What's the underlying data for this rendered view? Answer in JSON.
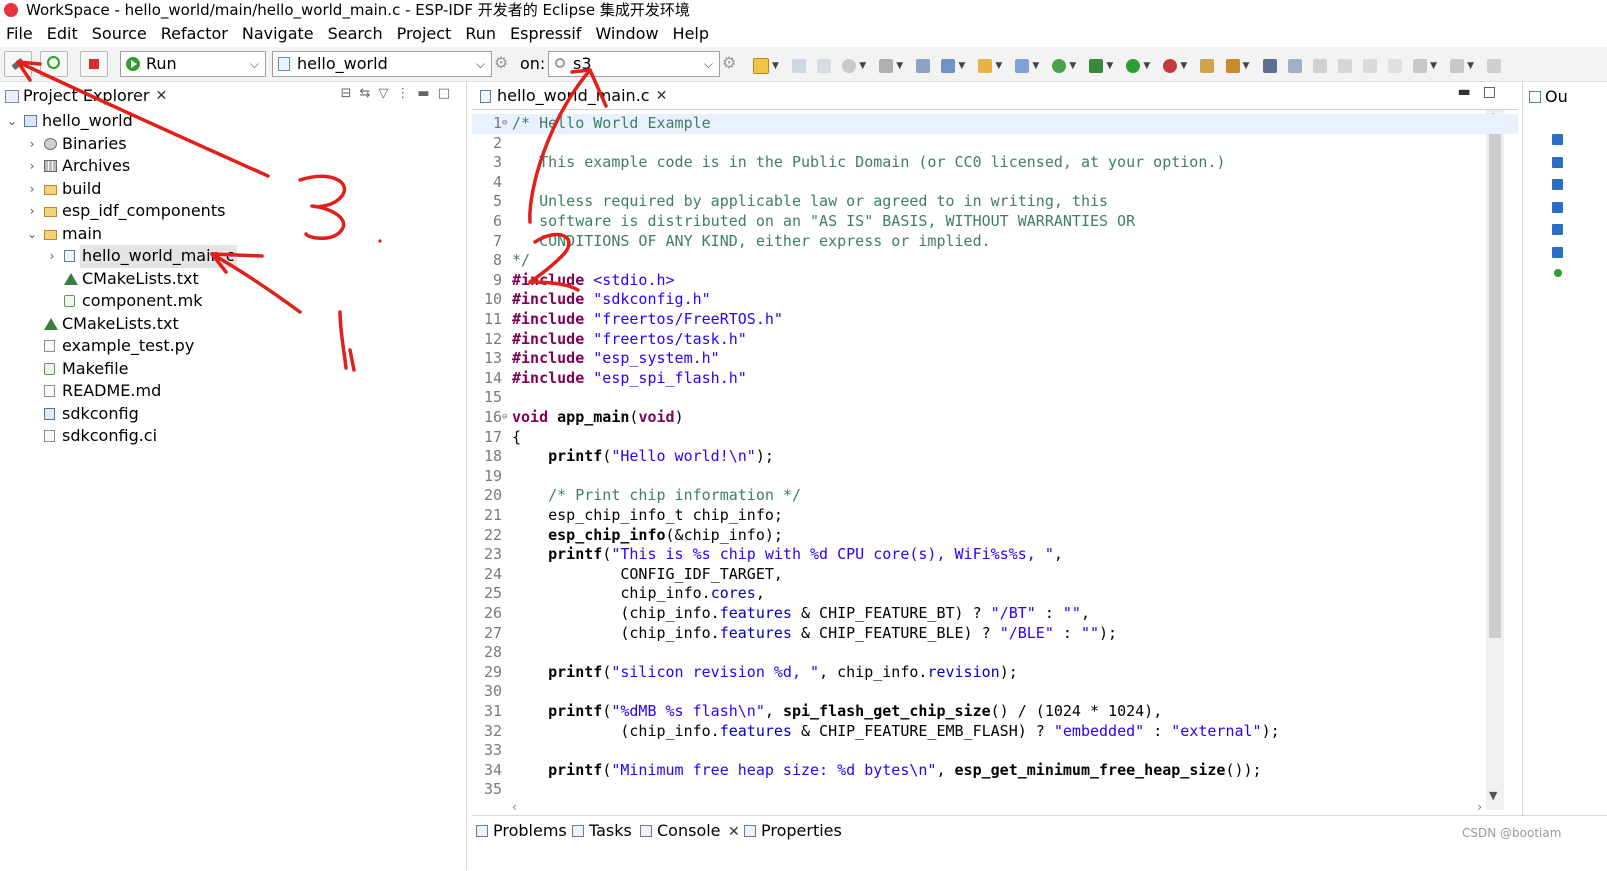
{
  "titlebar": {
    "title": "WorkSpace - hello_world/main/hello_world_main.c - ESP-IDF 开发者的 Eclipse 集成开发环境"
  },
  "menu": [
    "File",
    "Edit",
    "Source",
    "Refactor",
    "Navigate",
    "Search",
    "Project",
    "Run",
    "Espressif",
    "Window",
    "Help"
  ],
  "toolbar": {
    "launch_mode": "Run",
    "launch_config": "hello_world",
    "on_label": "on:",
    "target": "s3"
  },
  "project_explorer": {
    "tab_label": "Project Explorer",
    "tree": [
      {
        "label": "hello_world",
        "depth": 0,
        "chevron": "⌄",
        "icon": "project-icon"
      },
      {
        "label": "Binaries",
        "depth": 1,
        "chevron": "›",
        "icon": "binaries-icon"
      },
      {
        "label": "Archives",
        "depth": 1,
        "chevron": "›",
        "icon": "archives-icon"
      },
      {
        "label": "build",
        "depth": 1,
        "chevron": "›",
        "icon": "folder-icon"
      },
      {
        "label": "esp_idf_components",
        "depth": 1,
        "chevron": "›",
        "icon": "folder-icon"
      },
      {
        "label": "main",
        "depth": 1,
        "chevron": "⌄",
        "icon": "folder-icon"
      },
      {
        "label": "hello_world_main.c",
        "depth": 2,
        "chevron": "›",
        "icon": "c-file-icon",
        "selected": true
      },
      {
        "label": "CMakeLists.txt",
        "depth": 2,
        "chevron": "",
        "icon": "cmake-icon"
      },
      {
        "label": "component.mk",
        "depth": 2,
        "chevron": "",
        "icon": "makefile-icon"
      },
      {
        "label": "CMakeLists.txt",
        "depth": 1,
        "chevron": "",
        "icon": "cmake-icon"
      },
      {
        "label": "example_test.py",
        "depth": 1,
        "chevron": "",
        "icon": "file-icon"
      },
      {
        "label": "Makefile",
        "depth": 1,
        "chevron": "",
        "icon": "makefile-icon"
      },
      {
        "label": "README.md",
        "depth": 1,
        "chevron": "",
        "icon": "file-icon"
      },
      {
        "label": "sdkconfig",
        "depth": 1,
        "chevron": "",
        "icon": "settings-file-icon"
      },
      {
        "label": "sdkconfig.ci",
        "depth": 1,
        "chevron": "",
        "icon": "file-icon"
      }
    ]
  },
  "editor": {
    "tab_label": "hello_world_main.c",
    "lines": [
      {
        "n": "1",
        "fold": "⊖",
        "html": "<span class=\"cmt\">/* Hello World Example</span>"
      },
      {
        "n": "2",
        "html": ""
      },
      {
        "n": "3",
        "html": "<span class=\"cmt\">   This example code is in the Public Domain (or CC0 licensed, at your option.)</span>"
      },
      {
        "n": "4",
        "html": ""
      },
      {
        "n": "5",
        "html": "<span class=\"cmt\">   Unless required by applicable law or agreed to in writing, this</span>"
      },
      {
        "n": "6",
        "html": "<span class=\"cmt\">   software is distributed on an \"AS IS\" BASIS, WITHOUT WARRANTIES OR</span>"
      },
      {
        "n": "7",
        "html": "<span class=\"cmt\">   CONDITIONS OF ANY KIND, either express or implied.</span>"
      },
      {
        "n": "8",
        "html": "<span class=\"cmt\">*/</span>"
      },
      {
        "n": "9",
        "html": "<span class=\"kw\">#include</span> <span class=\"str\">&lt;stdio.h&gt;</span>"
      },
      {
        "n": "10",
        "html": "<span class=\"kw\">#include</span> <span class=\"str\">\"sdkconfig.h\"</span>"
      },
      {
        "n": "11",
        "html": "<span class=\"kw\">#include</span> <span class=\"str\">\"freertos/FreeRTOS.h\"</span>"
      },
      {
        "n": "12",
        "html": "<span class=\"kw\">#include</span> <span class=\"str\">\"freertos/task.h\"</span>"
      },
      {
        "n": "13",
        "html": "<span class=\"kw\">#include</span> <span class=\"str\">\"esp_system.h\"</span>"
      },
      {
        "n": "14",
        "html": "<span class=\"kw\">#include</span> <span class=\"str\">\"esp_spi_flash.h\"</span>"
      },
      {
        "n": "15",
        "html": ""
      },
      {
        "n": "16",
        "fold": "⊖",
        "html": "<span class=\"kw\">void</span> <span class=\"fn\">app_main</span>(<span class=\"kw\">void</span>)"
      },
      {
        "n": "17",
        "html": "{"
      },
      {
        "n": "18",
        "html": "    <span class=\"fn\">printf</span>(<span class=\"str\">\"Hello world!\\n\"</span>);"
      },
      {
        "n": "19",
        "html": ""
      },
      {
        "n": "20",
        "html": "    <span class=\"cmt\">/* Print chip information */</span>"
      },
      {
        "n": "21",
        "html": "    esp_chip_info_t chip_info;"
      },
      {
        "n": "22",
        "html": "    <span class=\"fn\">esp_chip_info</span>(&amp;chip_info);"
      },
      {
        "n": "23",
        "html": "    <span class=\"fn\">printf</span>(<span class=\"str\">\"This is %s chip with %d CPU core(s), WiFi%s%s, \"</span>,"
      },
      {
        "n": "24",
        "html": "            CONFIG_IDF_TARGET,"
      },
      {
        "n": "25",
        "html": "            chip_info.<span class=\"fld\">cores</span>,"
      },
      {
        "n": "26",
        "html": "            (chip_info.<span class=\"fld\">features</span> &amp; CHIP_FEATURE_BT) ? <span class=\"str\">\"/BT\"</span> : <span class=\"str\">\"\"</span>,"
      },
      {
        "n": "27",
        "html": "            (chip_info.<span class=\"fld\">features</span> &amp; CHIP_FEATURE_BLE) ? <span class=\"str\">\"/BLE\"</span> : <span class=\"str\">\"\"</span>);"
      },
      {
        "n": "28",
        "html": ""
      },
      {
        "n": "29",
        "html": "    <span class=\"fn\">printf</span>(<span class=\"str\">\"silicon revision %d, \"</span>, chip_info.<span class=\"fld\">revision</span>);"
      },
      {
        "n": "30",
        "html": ""
      },
      {
        "n": "31",
        "html": "    <span class=\"fn\">printf</span>(<span class=\"str\">\"%dMB %s flash\\n\"</span>, <span class=\"fn\">spi_flash_get_chip_size</span>() / (1024 * 1024),"
      },
      {
        "n": "32",
        "html": "            (chip_info.<span class=\"fld\">features</span> &amp; CHIP_FEATURE_EMB_FLASH) ? <span class=\"str\">\"embedded\"</span> : <span class=\"str\">\"external\"</span>);"
      },
      {
        "n": "33",
        "html": ""
      },
      {
        "n": "34",
        "html": "    <span class=\"fn\">printf</span>(<span class=\"str\">\"Minimum free heap size: %d bytes\\n\"</span>, <span class=\"fn\">esp_get_minimum_free_heap_size</span>());"
      },
      {
        "n": "35",
        "html": ""
      }
    ]
  },
  "outline": {
    "tab_label": "Ou"
  },
  "bottom_tabs": [
    "Problems",
    "Tasks",
    "Console",
    "Properties"
  ],
  "watermark": "CSDN @bootiam",
  "annotations": {
    "stroke_color": "#e0201b"
  },
  "colors": {
    "comment": "#3f7f5f",
    "keyword": "#7f0055",
    "string": "#2a00ff",
    "field": "#0000c0"
  }
}
